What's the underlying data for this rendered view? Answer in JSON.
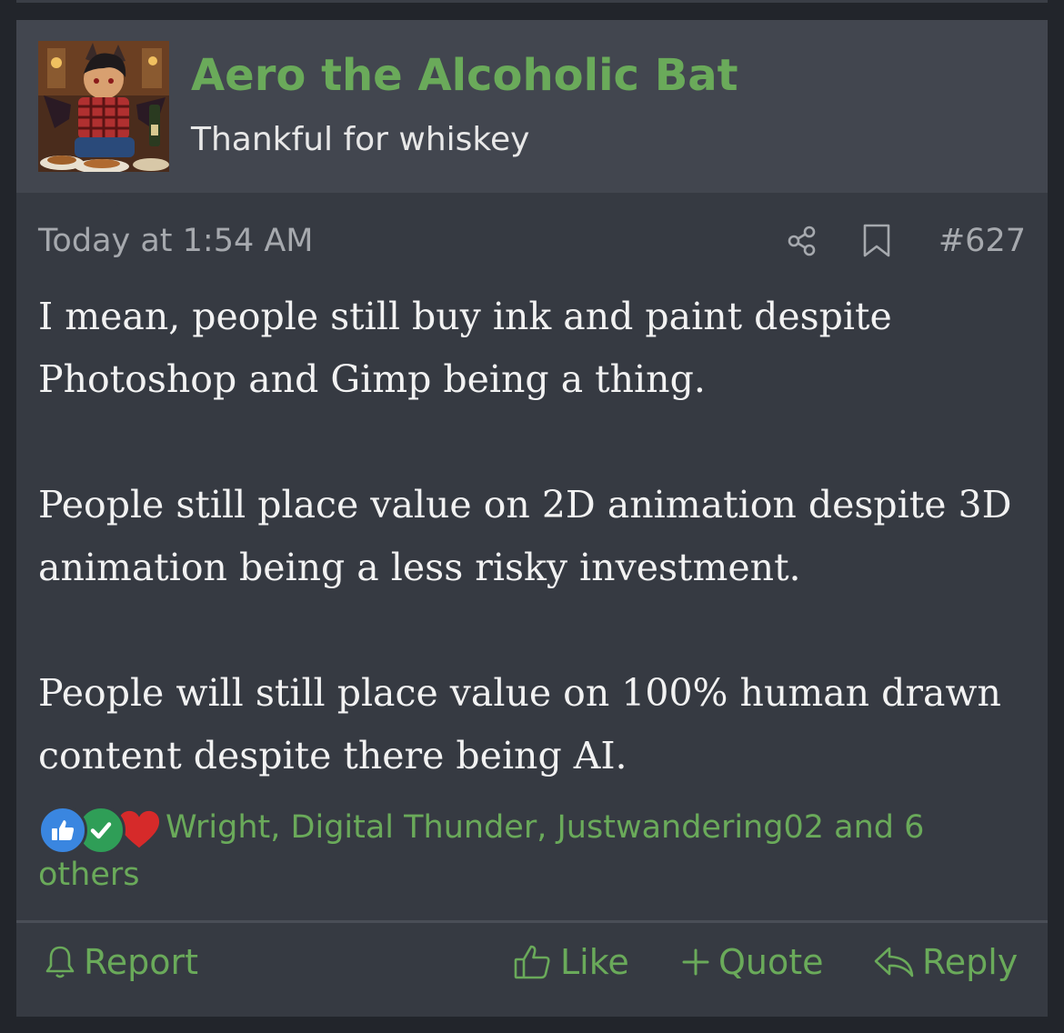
{
  "user": {
    "name": "Aero the Alcoholic Bat",
    "title": "Thankful for whiskey"
  },
  "meta": {
    "time": "Today at 1:54 AM",
    "post_number": "#627",
    "icons": [
      "share-icon",
      "bookmark-icon"
    ]
  },
  "message": {
    "paragraphs": [
      "I mean, people still buy ink and paint despite Photoshop and Gimp being a thing.",
      "People still place value on 2D animation despite 3D animation being a less risky investment.",
      "People will still place value on 100% human drawn content despite there being AI."
    ]
  },
  "reactions": {
    "icons": [
      "thumbs-up-icon",
      "checkmark-icon",
      "heart-icon"
    ],
    "text": "Wright, Digital Thunder, Justwandering02 and 6 others"
  },
  "actions": {
    "report": "Report",
    "like": "Like",
    "quote": "Quote",
    "reply": "Reply"
  },
  "colors": {
    "accent": "#6aaa5a",
    "background": "#363a42",
    "header": "#42464f",
    "text": "#f2f2f2",
    "muted": "#a6a9ae"
  }
}
